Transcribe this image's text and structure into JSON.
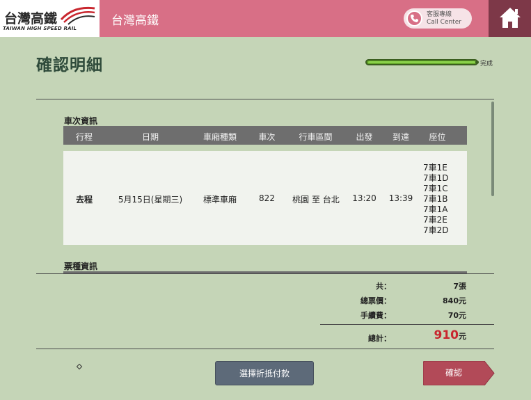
{
  "header": {
    "logo_zh": "台灣高鐵",
    "logo_en": "TAIWAN HIGH SPEED RAIL",
    "title": "台灣高鐵",
    "call_center_zh": "客服專線",
    "call_center_en": "Call Center",
    "home_icon": "home-icon"
  },
  "page": {
    "title": "確認明細",
    "progress_label": "完成",
    "progress_fraction": 1.0
  },
  "train_info": {
    "section_label": "車次資訊",
    "columns": [
      "行程",
      "日期",
      "車廂種類",
      "車次",
      "行車區間",
      "出發",
      "到達",
      "座位"
    ],
    "row": {
      "trip": "去程",
      "date": "5月15日(星期三)",
      "car_type": "標準車廂",
      "train_no": "822",
      "route": "桃園 至 台北",
      "depart": "13:20",
      "arrive": "13:39",
      "seats": [
        "7車1E",
        "7車1D",
        "7車1C",
        "7車1B",
        "7車1A",
        "7車2E",
        "7車2D"
      ]
    }
  },
  "ticket_info": {
    "section_label": "票種資訊"
  },
  "totals": {
    "count_label": "共：",
    "count_value": "7張",
    "fare_label": "總票價：",
    "fare_value": "840元",
    "fee_label": "手續費：",
    "fee_value": "70元",
    "total_label": "總計：",
    "total_number": "910",
    "total_unit": "元"
  },
  "footer": {
    "pay_button": "選擇折抵付款",
    "confirm_button": "確認"
  },
  "colors": {
    "header_bg": "#d86f86",
    "home_bg": "#7d3848",
    "page_bg": "#c5d5b7",
    "total_accent": "#c8262e",
    "pay_button": "#5d6a79",
    "confirm_button": "#b24a58"
  }
}
